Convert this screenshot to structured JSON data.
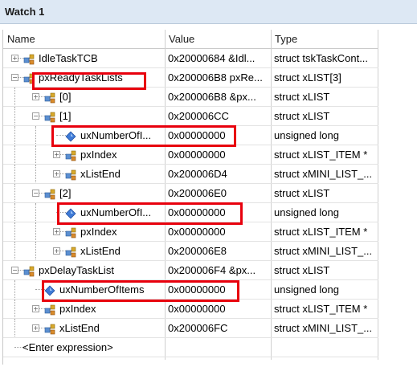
{
  "window": {
    "title": "Watch 1"
  },
  "columns": {
    "name": "Name",
    "value": "Value",
    "type": "Type"
  },
  "rows": [
    {
      "depth": 0,
      "expander": "+",
      "icon": "struct-icon",
      "name": "IdleTaskTCB",
      "value": "0x20000684 &Idl...",
      "type": "struct tskTaskCont..."
    },
    {
      "depth": 0,
      "expander": "-",
      "icon": "struct-icon",
      "name": "pxReadyTaskLists",
      "value": "0x200006B8 pxRe...",
      "type": "struct xLIST[3]"
    },
    {
      "depth": 1,
      "expander": "+",
      "icon": "struct-icon",
      "name": "[0]",
      "value": "0x200006B8 &px...",
      "type": "struct xLIST"
    },
    {
      "depth": 1,
      "expander": "-",
      "icon": "struct-icon",
      "name": "[1]",
      "value": "0x200006CC",
      "type": "struct xLIST"
    },
    {
      "depth": 2,
      "expander": "",
      "icon": "variable-icon",
      "name": "uxNumberOfI...",
      "value": "0x00000000",
      "type": "unsigned long"
    },
    {
      "depth": 2,
      "expander": "+",
      "icon": "struct-icon",
      "name": "pxIndex",
      "value": "0x00000000",
      "type": "struct xLIST_ITEM *"
    },
    {
      "depth": 2,
      "expander": "+",
      "icon": "struct-icon",
      "name": "xListEnd",
      "value": "0x200006D4",
      "type": "struct xMINI_LIST_..."
    },
    {
      "depth": 1,
      "expander": "-",
      "icon": "struct-icon",
      "name": "[2]",
      "value": "0x200006E0",
      "type": "struct xLIST"
    },
    {
      "depth": 2,
      "expander": "",
      "icon": "variable-icon",
      "name": "uxNumberOfI...",
      "value": "0x00000000",
      "type": "unsigned long"
    },
    {
      "depth": 2,
      "expander": "+",
      "icon": "struct-icon",
      "name": "pxIndex",
      "value": "0x00000000",
      "type": "struct xLIST_ITEM *"
    },
    {
      "depth": 2,
      "expander": "+",
      "icon": "struct-icon",
      "name": "xListEnd",
      "value": "0x200006E8",
      "type": "struct xMINI_LIST_..."
    },
    {
      "depth": 0,
      "expander": "-",
      "icon": "struct-icon",
      "name": "pxDelayTaskList",
      "value": "0x200006F4 &px...",
      "type": "struct xLIST"
    },
    {
      "depth": 1,
      "expander": "",
      "icon": "variable-icon",
      "name": "uxNumberOfItems",
      "value": "0x00000000",
      "type": "unsigned long"
    },
    {
      "depth": 1,
      "expander": "+",
      "icon": "struct-icon",
      "name": "pxIndex",
      "value": "0x00000000",
      "type": "struct xLIST_ITEM *"
    },
    {
      "depth": 1,
      "expander": "+",
      "icon": "struct-icon",
      "name": "xListEnd",
      "value": "0x200006FC",
      "type": "struct xMINI_LIST_..."
    },
    {
      "depth": 0,
      "expander": "",
      "icon": "",
      "name": "<Enter expression>",
      "value": "",
      "type": ""
    }
  ],
  "highlight_color": "#e8000d"
}
